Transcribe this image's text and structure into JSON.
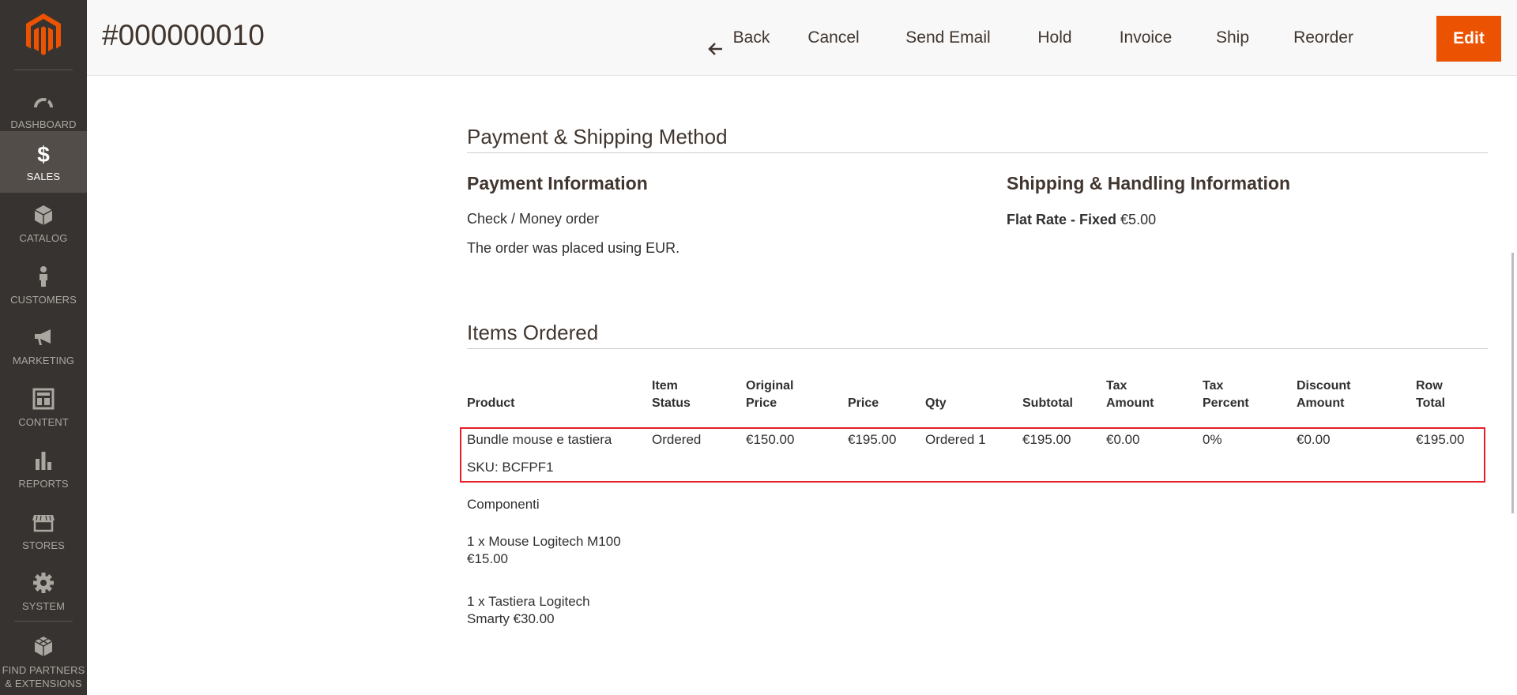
{
  "sidebar": {
    "items": [
      {
        "label": "DASHBOARD",
        "icon": "dashboard-icon"
      },
      {
        "label": "SALES",
        "icon": "dollar-icon"
      },
      {
        "label": "CATALOG",
        "icon": "box-icon"
      },
      {
        "label": "CUSTOMERS",
        "icon": "person-icon"
      },
      {
        "label": "MARKETING",
        "icon": "megaphone-icon"
      },
      {
        "label": "CONTENT",
        "icon": "layout-icon"
      },
      {
        "label": "REPORTS",
        "icon": "bar-chart-icon"
      },
      {
        "label": "STORES",
        "icon": "store-icon"
      },
      {
        "label": "SYSTEM",
        "icon": "gear-icon"
      },
      {
        "label_line1": "FIND PARTNERS",
        "label_line2": "& EXTENSIONS",
        "icon": "blocks-icon"
      }
    ],
    "active": "SALES",
    "colors": {
      "background": "#373330",
      "active": "#524d49",
      "logo": "#eb5202"
    }
  },
  "header": {
    "title": "#000000010",
    "actions": {
      "back": "Back",
      "cancel": "Cancel",
      "send_email": "Send Email",
      "hold": "Hold",
      "invoice": "Invoice",
      "ship": "Ship",
      "reorder": "Reorder",
      "edit": "Edit"
    },
    "accent": "#eb5202"
  },
  "payment_shipping": {
    "title": "Payment & Shipping Method",
    "payment_title": "Payment Information",
    "payment_method": "Check / Money order",
    "currency_note": "The order was placed using EUR.",
    "shipping_title": "Shipping & Handling Information",
    "shipping_method": "Flat Rate - Fixed",
    "shipping_price": "€5.00"
  },
  "items_ordered": {
    "title": "Items Ordered",
    "columns": [
      {
        "line1": "Product",
        "line2": ""
      },
      {
        "line1": "Item",
        "line2": "Status"
      },
      {
        "line1": "Original",
        "line2": "Price"
      },
      {
        "line1": "Price",
        "line2": ""
      },
      {
        "line1": "Qty",
        "line2": ""
      },
      {
        "line1": "Subtotal",
        "line2": ""
      },
      {
        "line1": "Tax",
        "line2": "Amount"
      },
      {
        "line1": "Tax",
        "line2": "Percent"
      },
      {
        "line1": "Discount",
        "line2": "Amount"
      },
      {
        "line1": "Row",
        "line2": "Total"
      }
    ],
    "row": {
      "product": "Bundle mouse e tastiera",
      "sku": "SKU: BCFPF1",
      "item_status": "Ordered",
      "original_price": "€150.00",
      "price": "€195.00",
      "qty": "Ordered 1",
      "subtotal": "€195.00",
      "tax_amount": "€0.00",
      "tax_percent": "0%",
      "discount_amount": "€0.00",
      "row_total": "€195.00"
    },
    "components_label": "Componenti",
    "components": [
      {
        "line1": "1 x Mouse Logitech M100",
        "line2": "€15.00"
      },
      {
        "line1": "1 x Tastiera Logitech",
        "line2": "Smarty €30.00"
      }
    ],
    "highlight_color": "#e41f28"
  }
}
